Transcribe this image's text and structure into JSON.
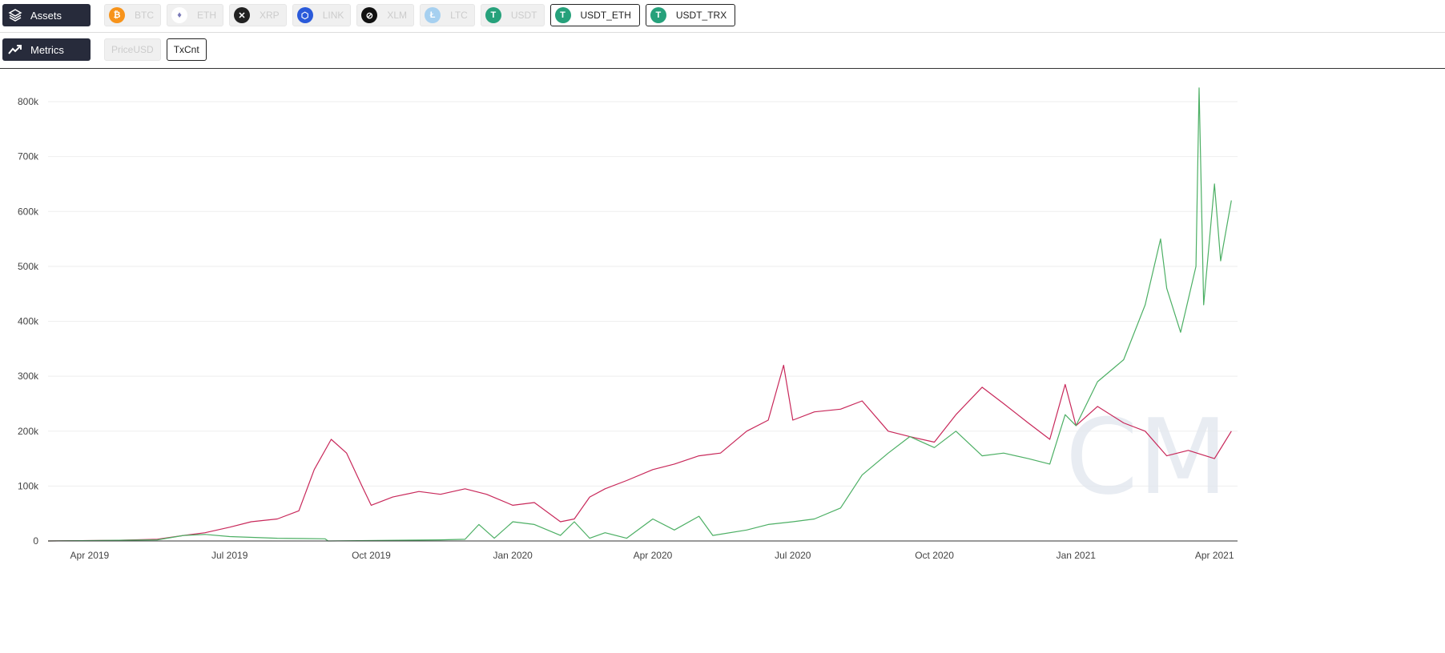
{
  "assets": {
    "label": "Assets",
    "items": [
      {
        "label": "BTC",
        "color": "#f7931a",
        "glyph": "₿",
        "active": false
      },
      {
        "label": "ETH",
        "color": "#ffffff",
        "glyph": "♦",
        "active": false
      },
      {
        "label": "XRP",
        "color": "#222222",
        "glyph": "✕",
        "active": false
      },
      {
        "label": "LINK",
        "color": "#2a5ada",
        "glyph": "⬡",
        "active": false
      },
      {
        "label": "XLM",
        "color": "#111111",
        "glyph": "⊘",
        "active": false
      },
      {
        "label": "LTC",
        "color": "#a6d0f0",
        "glyph": "Ł",
        "active": false
      },
      {
        "label": "USDT",
        "color": "#26a17b",
        "glyph": "T",
        "active": false
      },
      {
        "label": "USDT_ETH",
        "color": "#26a17b",
        "glyph": "T",
        "active": true
      },
      {
        "label": "USDT_TRX",
        "color": "#26a17b",
        "glyph": "T",
        "active": true
      }
    ]
  },
  "metrics": {
    "label": "Metrics",
    "items": [
      {
        "label": "PriceUSD",
        "active": false
      },
      {
        "label": "TxCnt",
        "active": true
      }
    ]
  },
  "watermark": "CM",
  "chart_data": {
    "type": "line",
    "ylabel": "TxCnt",
    "ylim": [
      0,
      800000
    ],
    "yticks": [
      {
        "v": 0,
        "label": "0"
      },
      {
        "v": 100000,
        "label": "100k"
      },
      {
        "v": 200000,
        "label": "200k"
      },
      {
        "v": 300000,
        "label": "300k"
      },
      {
        "v": 400000,
        "label": "400k"
      },
      {
        "v": 500000,
        "label": "500k"
      },
      {
        "v": 600000,
        "label": "600k"
      },
      {
        "v": 700000,
        "label": "700k"
      },
      {
        "v": 800000,
        "label": "800k"
      }
    ],
    "xlim": [
      "2019-03-05",
      "2021-04-16"
    ],
    "xticks": [
      {
        "d": "2019-04-01",
        "label": "Apr 2019"
      },
      {
        "d": "2019-07-01",
        "label": "Jul 2019"
      },
      {
        "d": "2019-10-01",
        "label": "Oct 2019"
      },
      {
        "d": "2020-01-01",
        "label": "Jan 2020"
      },
      {
        "d": "2020-04-01",
        "label": "Apr 2020"
      },
      {
        "d": "2020-07-01",
        "label": "Jul 2020"
      },
      {
        "d": "2020-10-01",
        "label": "Oct 2020"
      },
      {
        "d": "2021-01-01",
        "label": "Jan 2021"
      },
      {
        "d": "2021-04-01",
        "label": "Apr 2021"
      }
    ],
    "grid": true,
    "series": [
      {
        "name": "USDT_ETH",
        "color": "#c8285a",
        "points": [
          [
            "2019-03-05",
            0
          ],
          [
            "2019-04-15",
            1000
          ],
          [
            "2019-05-15",
            3000
          ],
          [
            "2019-06-01",
            10000
          ],
          [
            "2019-06-15",
            15000
          ],
          [
            "2019-07-01",
            25000
          ],
          [
            "2019-07-15",
            35000
          ],
          [
            "2019-08-01",
            40000
          ],
          [
            "2019-08-15",
            55000
          ],
          [
            "2019-08-25",
            130000
          ],
          [
            "2019-09-05",
            185000
          ],
          [
            "2019-09-15",
            160000
          ],
          [
            "2019-09-25",
            100000
          ],
          [
            "2019-10-01",
            65000
          ],
          [
            "2019-10-15",
            80000
          ],
          [
            "2019-11-01",
            90000
          ],
          [
            "2019-11-15",
            85000
          ],
          [
            "2019-12-01",
            95000
          ],
          [
            "2019-12-15",
            85000
          ],
          [
            "2020-01-01",
            65000
          ],
          [
            "2020-01-15",
            70000
          ],
          [
            "2020-02-01",
            35000
          ],
          [
            "2020-02-10",
            40000
          ],
          [
            "2020-02-20",
            80000
          ],
          [
            "2020-03-01",
            95000
          ],
          [
            "2020-03-15",
            110000
          ],
          [
            "2020-04-01",
            130000
          ],
          [
            "2020-04-15",
            140000
          ],
          [
            "2020-05-01",
            155000
          ],
          [
            "2020-05-15",
            160000
          ],
          [
            "2020-06-01",
            200000
          ],
          [
            "2020-06-15",
            220000
          ],
          [
            "2020-06-25",
            320000
          ],
          [
            "2020-07-01",
            220000
          ],
          [
            "2020-07-15",
            235000
          ],
          [
            "2020-08-01",
            240000
          ],
          [
            "2020-08-15",
            255000
          ],
          [
            "2020-09-01",
            200000
          ],
          [
            "2020-09-15",
            190000
          ],
          [
            "2020-10-01",
            180000
          ],
          [
            "2020-10-15",
            230000
          ],
          [
            "2020-11-01",
            280000
          ],
          [
            "2020-11-15",
            250000
          ],
          [
            "2020-12-01",
            215000
          ],
          [
            "2020-12-15",
            185000
          ],
          [
            "2020-12-25",
            285000
          ],
          [
            "2021-01-01",
            210000
          ],
          [
            "2021-01-15",
            245000
          ],
          [
            "2021-02-01",
            215000
          ],
          [
            "2021-02-15",
            200000
          ],
          [
            "2021-03-01",
            155000
          ],
          [
            "2021-03-15",
            165000
          ],
          [
            "2021-04-01",
            150000
          ],
          [
            "2021-04-12",
            200000
          ]
        ]
      },
      {
        "name": "USDT_TRX",
        "color": "#4caf64",
        "points": [
          [
            "2019-03-05",
            0
          ],
          [
            "2019-05-15",
            2000
          ],
          [
            "2019-06-01",
            10000
          ],
          [
            "2019-06-15",
            12000
          ],
          [
            "2019-07-01",
            8000
          ],
          [
            "2019-08-01",
            5000
          ],
          [
            "2019-09-01",
            4000
          ],
          [
            "2019-09-03",
            0
          ],
          [
            "2019-11-15",
            2000
          ],
          [
            "2019-12-01",
            3000
          ],
          [
            "2019-12-10",
            30000
          ],
          [
            "2019-12-20",
            5000
          ],
          [
            "2020-01-01",
            35000
          ],
          [
            "2020-01-15",
            30000
          ],
          [
            "2020-02-01",
            10000
          ],
          [
            "2020-02-10",
            35000
          ],
          [
            "2020-02-20",
            5000
          ],
          [
            "2020-03-01",
            15000
          ],
          [
            "2020-03-15",
            5000
          ],
          [
            "2020-04-01",
            40000
          ],
          [
            "2020-04-15",
            20000
          ],
          [
            "2020-05-01",
            45000
          ],
          [
            "2020-05-10",
            10000
          ],
          [
            "2020-06-01",
            20000
          ],
          [
            "2020-06-15",
            30000
          ],
          [
            "2020-07-01",
            35000
          ],
          [
            "2020-07-15",
            40000
          ],
          [
            "2020-08-01",
            60000
          ],
          [
            "2020-08-15",
            120000
          ],
          [
            "2020-09-01",
            160000
          ],
          [
            "2020-09-15",
            190000
          ],
          [
            "2020-10-01",
            170000
          ],
          [
            "2020-10-15",
            200000
          ],
          [
            "2020-11-01",
            155000
          ],
          [
            "2020-11-15",
            160000
          ],
          [
            "2020-12-01",
            150000
          ],
          [
            "2020-12-15",
            140000
          ],
          [
            "2020-12-25",
            230000
          ],
          [
            "2021-01-01",
            210000
          ],
          [
            "2021-01-15",
            290000
          ],
          [
            "2021-02-01",
            330000
          ],
          [
            "2021-02-15",
            430000
          ],
          [
            "2021-02-25",
            550000
          ],
          [
            "2021-03-01",
            460000
          ],
          [
            "2021-03-10",
            380000
          ],
          [
            "2021-03-20",
            500000
          ],
          [
            "2021-03-22",
            825000
          ],
          [
            "2021-03-25",
            430000
          ],
          [
            "2021-04-01",
            650000
          ],
          [
            "2021-04-05",
            510000
          ],
          [
            "2021-04-12",
            620000
          ]
        ]
      }
    ]
  }
}
